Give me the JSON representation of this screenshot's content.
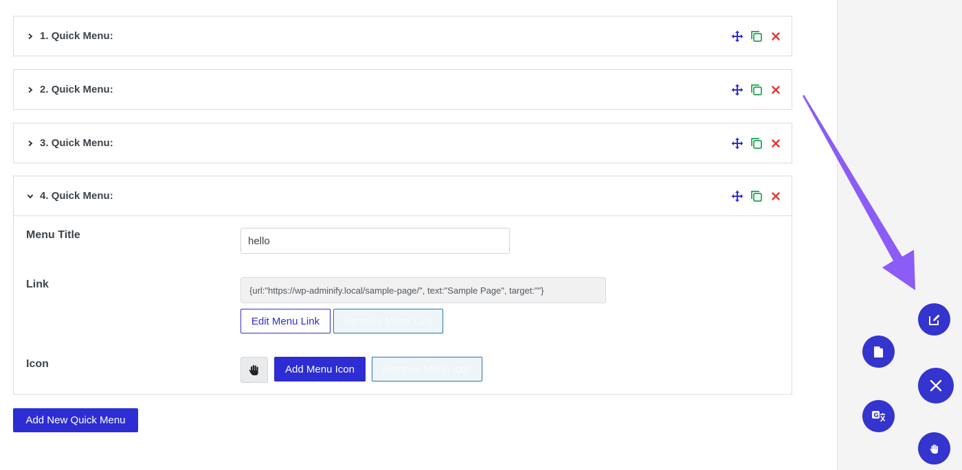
{
  "accordions": [
    {
      "number": "1.",
      "title": "Quick Menu:",
      "expanded": false
    },
    {
      "number": "2.",
      "title": "Quick Menu:",
      "expanded": false
    },
    {
      "number": "3.",
      "title": "Quick Menu:",
      "expanded": false
    },
    {
      "number": "4.",
      "title": "Quick Menu:",
      "expanded": true
    }
  ],
  "form": {
    "menu_title_label": "Menu Title",
    "menu_title_value": "hello",
    "link_label": "Link",
    "link_value": "{url:\"https://wp-adminify.local/sample-page/\", text:\"Sample Page\", target:\"\"}",
    "edit_link_button": "Edit Menu Link",
    "remove_link_button": "Remove Menu Link",
    "icon_label": "Icon",
    "icon_preview": "hand-icon",
    "add_icon_button": "Add Menu Icon",
    "remove_icon_button": "Remove Menu Icon"
  },
  "add_new_button": "Add New Quick Menu",
  "colors": {
    "primary": "#2d2dd3",
    "move": "#2d2dd3",
    "clone": "#16a34a",
    "remove": "#e53935",
    "fab": "#3434cf",
    "arrow": "#8b5cf6"
  },
  "fab_icons": [
    "edit-icon",
    "new-page-icon",
    "close-icon",
    "translate-icon",
    "hand-icon"
  ]
}
